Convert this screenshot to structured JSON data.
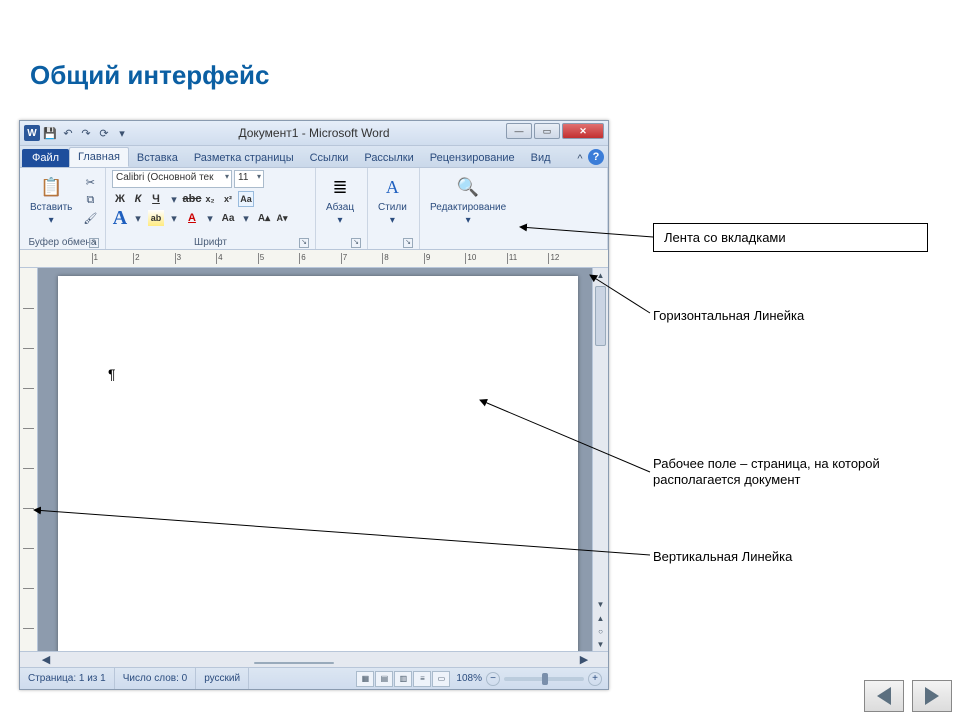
{
  "slide": {
    "title": "Общий интерфейс"
  },
  "window": {
    "title": "Документ1  -  Microsoft Word",
    "logo_letter": "W"
  },
  "qat": {
    "save": "💾",
    "undo": "↶",
    "redo": "↷",
    "repeat": "⟳",
    "customize": "▾"
  },
  "tabs": {
    "file": "Файл",
    "home": "Главная",
    "insert": "Вставка",
    "layout": "Разметка страницы",
    "refs": "Ссылки",
    "mail": "Рассылки",
    "review": "Рецензирование",
    "view": "Вид"
  },
  "ribbon": {
    "clipboard": {
      "paste": "Вставить",
      "group": "Буфер обмена"
    },
    "font": {
      "group": "Шрифт",
      "name": "Calibri (Основной тек",
      "size": "11",
      "bold": "Ж",
      "italic": "К",
      "underline": "Ч",
      "strike": "abc",
      "sub": "x₂",
      "sup": "x²",
      "caseAa": "Aa",
      "clear": "Aᵃ",
      "grow": "A▴",
      "shrink": "A▾"
    },
    "paragraph": {
      "group": "Абзац"
    },
    "styles": {
      "group": "Стили"
    },
    "editing": {
      "group": "Редактирование"
    }
  },
  "ruler": {
    "numbers": [
      "1",
      "2",
      "3",
      "4",
      "5",
      "6",
      "7",
      "8",
      "9",
      "10",
      "11",
      "12"
    ]
  },
  "page": {
    "pilcrow": "¶"
  },
  "status": {
    "page": "Страница: 1 из 1",
    "words": "Число слов: 0",
    "lang": "русский",
    "zoom": "108%"
  },
  "callouts": {
    "ribbon": "Лента со вкладками",
    "hruler": "Горизонтальная Линейка",
    "workarea": "Рабочее поле – страница, на которой располагается документ",
    "vruler": "Вертикальная Линейка"
  }
}
